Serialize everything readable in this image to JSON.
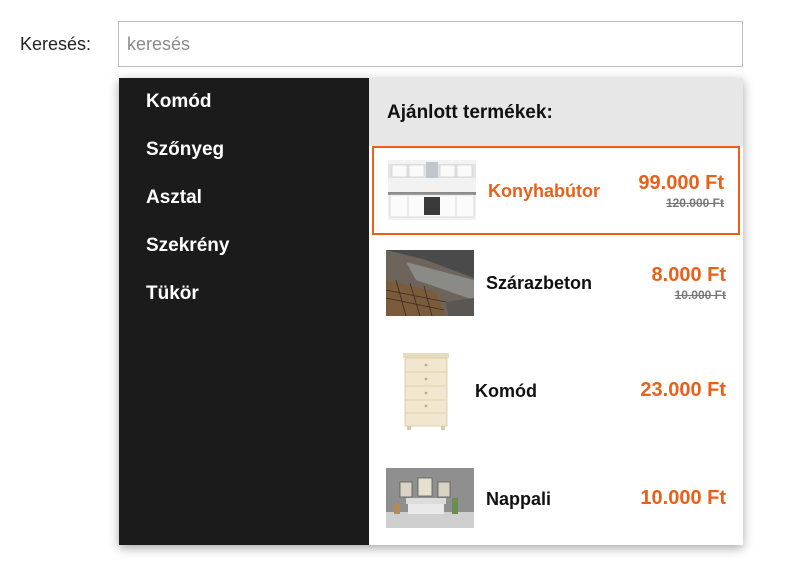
{
  "search": {
    "label": "Keresés:",
    "placeholder": "keresés",
    "value": ""
  },
  "categories": [
    {
      "label": "Komód"
    },
    {
      "label": "Szőnyeg"
    },
    {
      "label": "Asztal"
    },
    {
      "label": "Szekrény"
    },
    {
      "label": "Tükör"
    }
  ],
  "products_header": "Ajánlott termékek:",
  "products": [
    {
      "name": "Konyhabútor",
      "price": "99.000 Ft",
      "old_price": "120.000 Ft",
      "highlighted": true,
      "image": "kitchen-cabinets-thumbnail"
    },
    {
      "name": "Szárazbeton",
      "price": "8.000 Ft",
      "old_price": "10.000 Ft",
      "highlighted": false,
      "image": "dry-concrete-thumbnail"
    },
    {
      "name": "Komód",
      "price": "23.000 Ft",
      "old_price": "",
      "highlighted": false,
      "image": "dresser-thumbnail"
    },
    {
      "name": "Nappali",
      "price": "10.000 Ft",
      "old_price": "",
      "highlighted": false,
      "image": "living-room-thumbnail"
    }
  ],
  "colors": {
    "accent": "#ea6019",
    "category_bg": "#1b1b1b",
    "header_bg": "#e7e7e7"
  }
}
